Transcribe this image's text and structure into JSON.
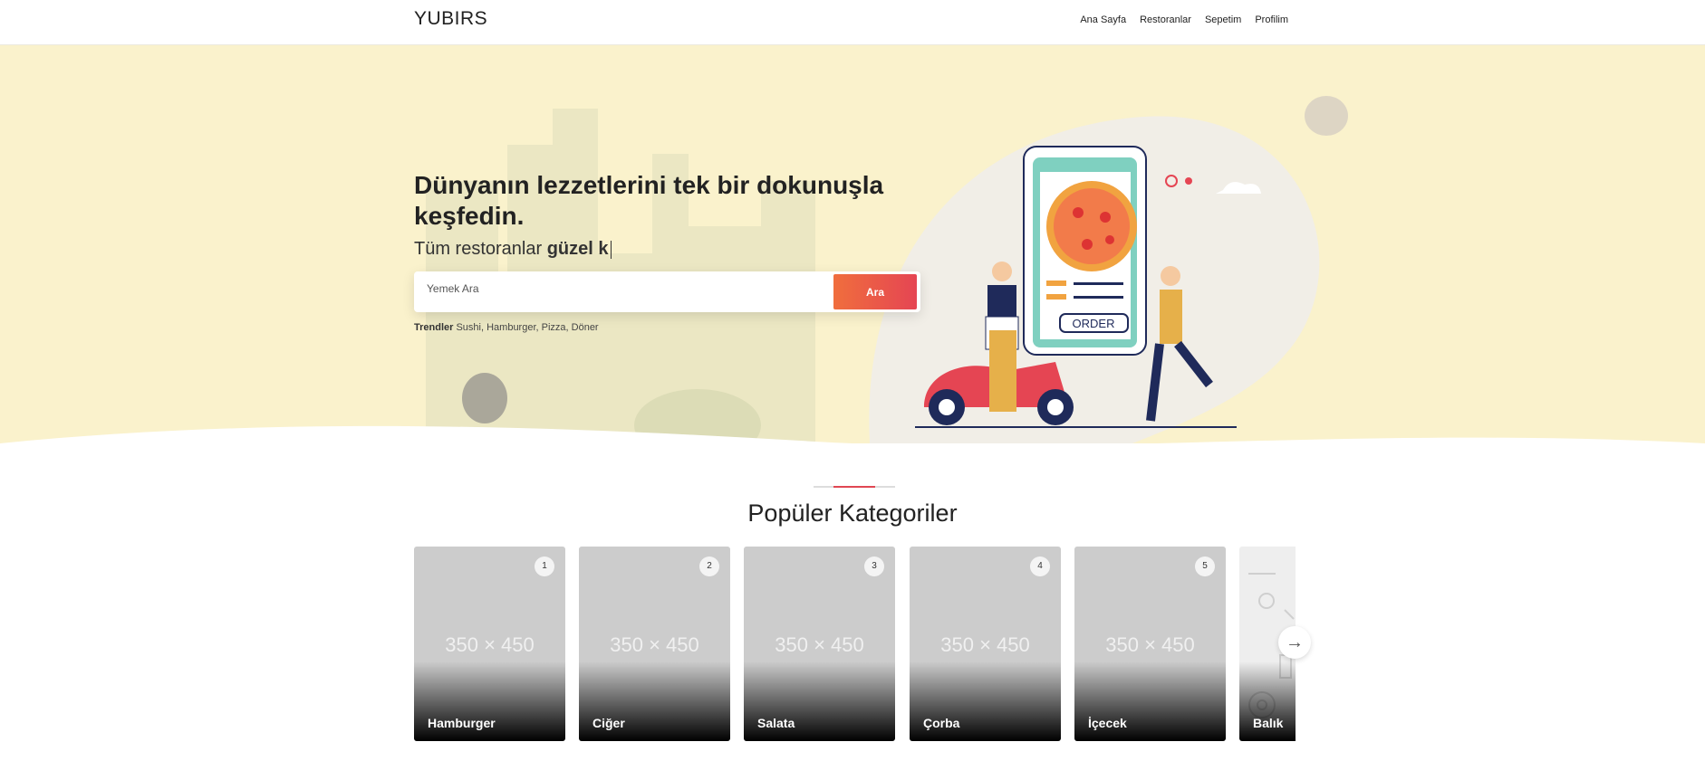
{
  "header": {
    "logo": "YUBIRS",
    "nav": [
      "Ana Sayfa",
      "Restoranlar",
      "Sepetim",
      "Profilim"
    ]
  },
  "hero": {
    "title": "Dünyanın lezzetlerini tek bir dokunuşla keşfedin.",
    "subtitle_prefix": "Tüm restoranlar ",
    "subtitle_typed": "güzel k",
    "search_placeholder": "Yemek Ara",
    "search_button": "Ara",
    "trends_label": "Trendler",
    "trends": "Sushi, Hamburger, Pizza, Döner",
    "illustration_text": "ORDER"
  },
  "categories": {
    "title": "Popüler Kategoriler",
    "items": [
      {
        "rank": "1",
        "name": "Hamburger",
        "placeholder": "350 × 450"
      },
      {
        "rank": "2",
        "name": "Ciğer",
        "placeholder": "350 × 450"
      },
      {
        "rank": "3",
        "name": "Salata",
        "placeholder": "350 × 450"
      },
      {
        "rank": "4",
        "name": "Çorba",
        "placeholder": "350 × 450"
      },
      {
        "rank": "5",
        "name": "İçecek",
        "placeholder": "350 × 450"
      },
      {
        "name": "Balık"
      }
    ],
    "next_icon": "arrow-right-icon"
  },
  "colors": {
    "hero_bg": "#faf2cc",
    "accent": "#e54553",
    "accent2": "#f06e3d"
  }
}
